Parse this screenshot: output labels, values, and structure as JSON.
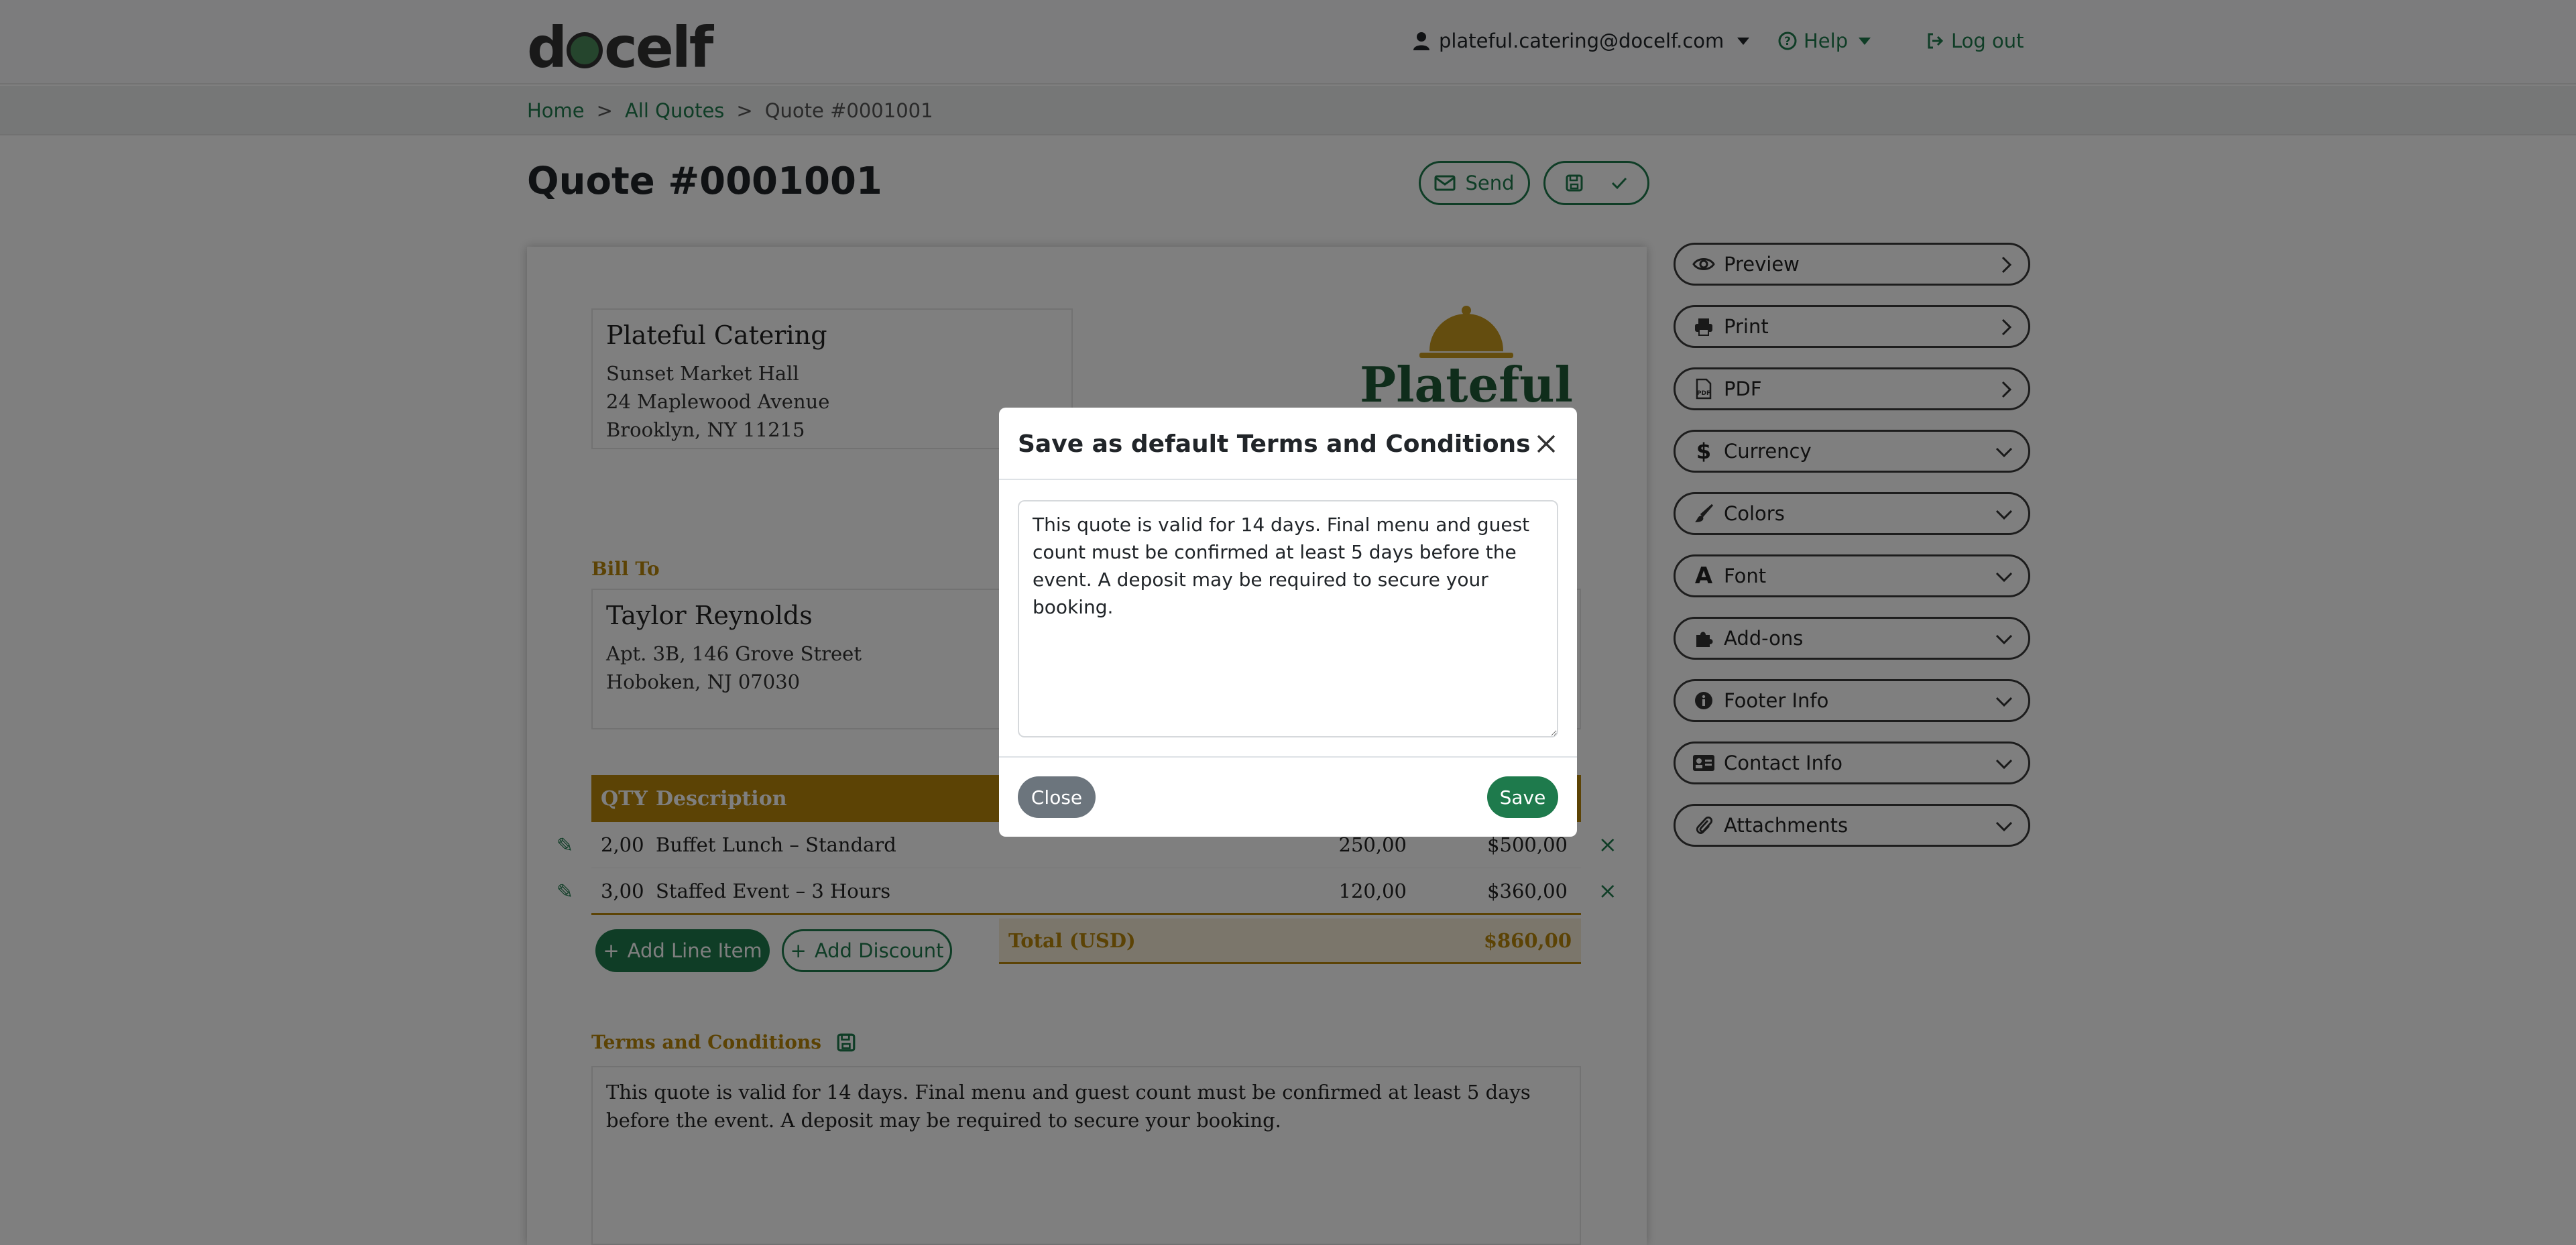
{
  "nav": {
    "logo_text": "docelf",
    "user_email": "plateful.catering@docelf.com",
    "help_label": "Help",
    "logout_label": "Log out"
  },
  "breadcrumb": {
    "home": "Home",
    "all_quotes": "All Quotes",
    "current": "Quote #0001001",
    "separator": ">"
  },
  "page": {
    "title": "Quote #0001001",
    "send_label": "Send"
  },
  "document": {
    "from": {
      "name": "Plateful Catering",
      "lines": [
        "Sunset Market Hall",
        "24 Maplewood Avenue",
        "Brooklyn, NY 11215"
      ]
    },
    "brand_word": "Plateful",
    "bill_to_label": "Bill To",
    "bill_to": {
      "name": "Taylor Reynolds",
      "lines": [
        "Apt. 3B, 146 Grove Street",
        "Hoboken, NJ 07030"
      ]
    },
    "table": {
      "headers": {
        "qty": "QTY",
        "description": "Description"
      },
      "rows": [
        {
          "qty": "2,00",
          "description": "Buffet Lunch – Standard",
          "price": "250,00",
          "amount": "$500,00"
        },
        {
          "qty": "3,00",
          "description": "Staffed Event – 3 Hours",
          "price": "120,00",
          "amount": "$360,00"
        }
      ]
    },
    "add_line_item_label": "Add Line Item",
    "add_discount_label": "Add Discount",
    "total_label": "Total (USD)",
    "total_value": "$860,00",
    "terms_label": "Terms and Conditions",
    "terms_text": "This quote is valid for 14 days. Final menu and guest count must be confirmed at least 5 days before the event. A deposit may be required to secure your booking."
  },
  "sidebar": {
    "items": [
      {
        "label": "Preview",
        "icon": "eye-icon",
        "arrow": "chevron-right"
      },
      {
        "label": "Print",
        "icon": "printer-icon",
        "arrow": "chevron-right"
      },
      {
        "label": "PDF",
        "icon": "pdf-file-icon",
        "arrow": "chevron-right"
      },
      {
        "label": "Currency",
        "icon": "dollar-icon",
        "arrow": "chevron-down"
      },
      {
        "label": "Colors",
        "icon": "brush-icon",
        "arrow": "chevron-down"
      },
      {
        "label": "Font",
        "icon": "font-icon",
        "arrow": "chevron-down"
      },
      {
        "label": "Add-ons",
        "icon": "puzzle-icon",
        "arrow": "chevron-down"
      },
      {
        "label": "Footer Info",
        "icon": "info-icon",
        "arrow": "chevron-down"
      },
      {
        "label": "Contact Info",
        "icon": "id-card-icon",
        "arrow": "chevron-down"
      },
      {
        "label": "Attachments",
        "icon": "paperclip-icon",
        "arrow": "chevron-down"
      }
    ]
  },
  "modal": {
    "title": "Save as default Terms and Conditions",
    "textarea_value": "This quote is valid for 14 days. Final menu and guest count must be confirmed at least 5 days before the event. A deposit may be required to secure your booking.",
    "close_label": "Close",
    "save_label": "Save"
  },
  "colors": {
    "brand_green": "#1e7a4c",
    "gold": "#b8860b",
    "overlay": "rgba(0,0,0,0.5)"
  }
}
